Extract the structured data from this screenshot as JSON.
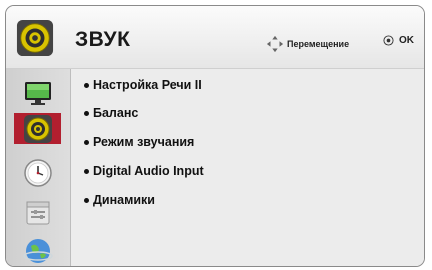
{
  "header": {
    "title": "ЗВУК",
    "icon": "speaker-icon",
    "move_hint": "Перемещение",
    "ok_hint": "OK"
  },
  "sidebar": {
    "items": [
      {
        "icon": "picture-icon",
        "selected": false
      },
      {
        "icon": "speaker-icon",
        "selected": true
      },
      {
        "icon": "clock-icon",
        "selected": false
      },
      {
        "icon": "options-icon",
        "selected": false
      },
      {
        "icon": "network-icon",
        "selected": false
      }
    ]
  },
  "menu": {
    "items": [
      {
        "label": "Настройка Речи II"
      },
      {
        "label": "Баланс"
      },
      {
        "label": "Режим звучания"
      },
      {
        "label": "Digital Audio Input"
      },
      {
        "label": "Динамики"
      }
    ]
  },
  "colors": {
    "selected": "#b21f2f",
    "speaker_ring": "#c9b400"
  }
}
